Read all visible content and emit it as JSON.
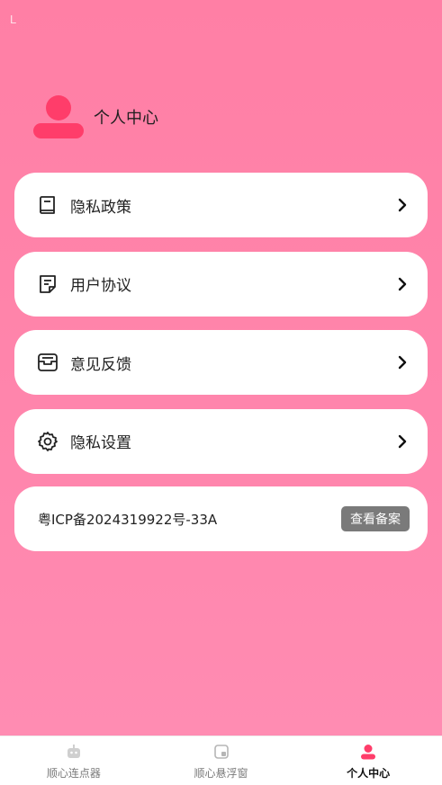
{
  "status": {
    "mark": "L"
  },
  "profile": {
    "title": "个人中心",
    "avatar_icon": "user-avatar-icon"
  },
  "menu": [
    {
      "label": "隐私政策",
      "icon": "book-icon"
    },
    {
      "label": "用户协议",
      "icon": "document-icon"
    },
    {
      "label": "意见反馈",
      "icon": "inbox-icon"
    },
    {
      "label": "隐私设置",
      "icon": "gear-icon"
    }
  ],
  "icp": {
    "text": "粤ICP备2024319922号-33A",
    "button_label": "查看备案"
  },
  "tabs": [
    {
      "label": "顺心连点器",
      "icon": "robot-icon",
      "active": false
    },
    {
      "label": "顺心悬浮窗",
      "icon": "floating-window-icon",
      "active": false
    },
    {
      "label": "个人中心",
      "icon": "person-icon",
      "active": true
    }
  ],
  "colors": {
    "accent": "#ff3d6a",
    "background": "#ff82a9",
    "button_gray": "#7a7a7a"
  }
}
